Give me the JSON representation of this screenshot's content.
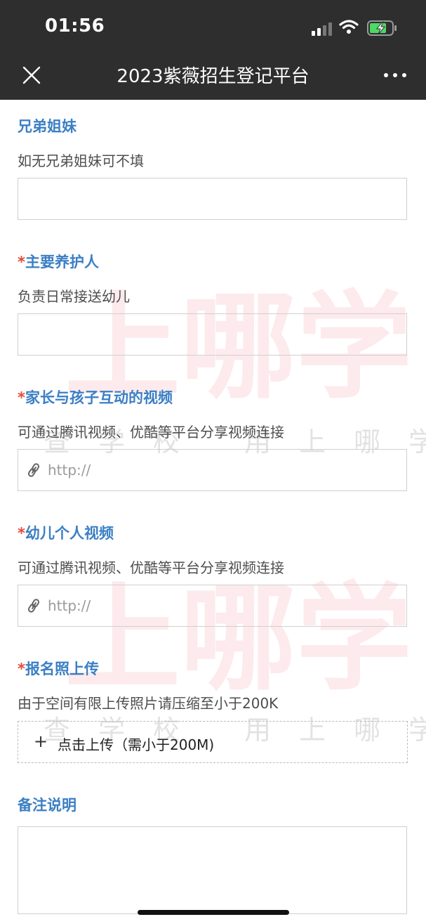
{
  "status_bar": {
    "time": "01:56"
  },
  "nav": {
    "title": "2023紫薇招生登记平台"
  },
  "watermark": {
    "big": "上哪学",
    "small": "查学校 用上哪学"
  },
  "fields": [
    {
      "label": "兄弟姐妹",
      "required": false,
      "hint": "如无兄弟姐妹可不填",
      "value": ""
    },
    {
      "label": "主要养护人",
      "required": true,
      "hint": "负责日常接送幼儿",
      "value": ""
    },
    {
      "label": "家长与孩子互动的视频",
      "required": true,
      "hint": "可通过腾讯视频、优酷等平台分享视频连接",
      "placeholder": "http://"
    },
    {
      "label": "幼儿个人视频",
      "required": true,
      "hint": "可通过腾讯视频、优酷等平台分享视频连接",
      "placeholder": "http://"
    },
    {
      "label": "报名照上传",
      "required": true,
      "hint": "由于空间有限上传照片请压缩至小于200K",
      "upload_plus": "+",
      "upload_text": "点击上传（需小于200M)"
    },
    {
      "label": "备注说明",
      "required": false,
      "value": ""
    }
  ],
  "required_mark": "*",
  "colors": {
    "label_blue": "#3b7fc4",
    "required_red": "#e54a3a",
    "topbar": "#2e2e2e"
  },
  "icons": [
    "close-icon",
    "more-icon",
    "link-icon",
    "signal-icon",
    "wifi-icon",
    "battery-charging-icon"
  ]
}
